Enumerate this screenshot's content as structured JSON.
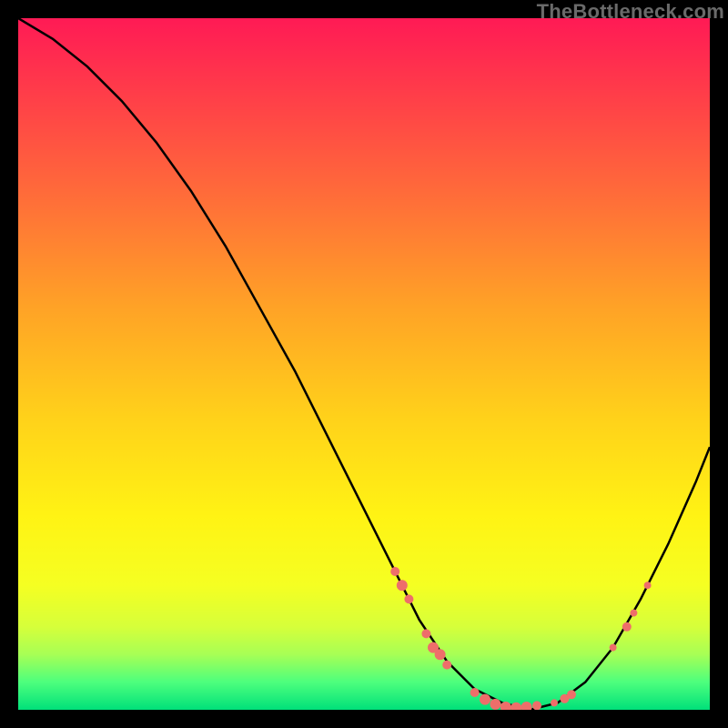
{
  "watermark": "TheBottleneck.com",
  "colors": {
    "background": "#000000",
    "gradient_top": "#ff1a55",
    "gradient_bottom": "#00e07a",
    "curve": "#000000",
    "marker": "#ee6e6a"
  },
  "chart_data": {
    "type": "line",
    "title": "",
    "xlabel": "",
    "ylabel": "",
    "xlim": [
      0,
      100
    ],
    "ylim": [
      0,
      100
    ],
    "curve": {
      "x": [
        0,
        5,
        10,
        15,
        20,
        25,
        30,
        35,
        40,
        45,
        50,
        54,
        58,
        62,
        66,
        70,
        74,
        78,
        82,
        86,
        90,
        94,
        98,
        100
      ],
      "y": [
        100,
        97,
        93,
        88,
        82,
        75,
        67,
        58,
        49,
        39,
        29,
        21,
        13,
        7,
        3,
        1,
        0,
        1,
        4,
        9,
        16,
        24,
        33,
        38
      ]
    },
    "markers": [
      {
        "x": 54.5,
        "y": 20,
        "r": 5
      },
      {
        "x": 55.5,
        "y": 18,
        "r": 6
      },
      {
        "x": 56.5,
        "y": 16,
        "r": 5
      },
      {
        "x": 59,
        "y": 11,
        "r": 5
      },
      {
        "x": 60,
        "y": 9,
        "r": 6
      },
      {
        "x": 61,
        "y": 8,
        "r": 6
      },
      {
        "x": 62,
        "y": 6.5,
        "r": 5
      },
      {
        "x": 66,
        "y": 2.5,
        "r": 5
      },
      {
        "x": 67.5,
        "y": 1.5,
        "r": 6
      },
      {
        "x": 69,
        "y": 0.8,
        "r": 6
      },
      {
        "x": 70.5,
        "y": 0.4,
        "r": 6
      },
      {
        "x": 72,
        "y": 0.3,
        "r": 6
      },
      {
        "x": 73.5,
        "y": 0.4,
        "r": 6
      },
      {
        "x": 75,
        "y": 0.6,
        "r": 5
      },
      {
        "x": 77.5,
        "y": 1.0,
        "r": 4
      },
      {
        "x": 79,
        "y": 1.6,
        "r": 5
      },
      {
        "x": 80,
        "y": 2.2,
        "r": 5
      },
      {
        "x": 86,
        "y": 9,
        "r": 4
      },
      {
        "x": 88,
        "y": 12,
        "r": 5
      },
      {
        "x": 89,
        "y": 14,
        "r": 4
      },
      {
        "x": 91,
        "y": 18,
        "r": 4
      }
    ]
  }
}
